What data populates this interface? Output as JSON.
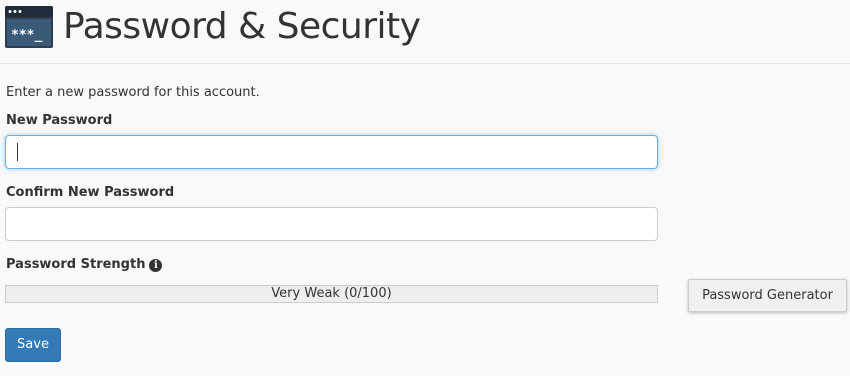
{
  "header": {
    "title": "Password & Security",
    "icon": "password-terminal-icon",
    "icon_text": "***_"
  },
  "form": {
    "description": "Enter a new password for this account.",
    "new_password": {
      "label": "New Password",
      "value": "",
      "placeholder": ""
    },
    "confirm_password": {
      "label": "Confirm New Password",
      "value": "",
      "placeholder": ""
    },
    "strength": {
      "label": "Password Strength",
      "info_icon": "info-circle-icon",
      "text": "Very Weak (0/100)",
      "score": 0,
      "max": 100
    },
    "generator_label": "Password Generator",
    "save_label": "Save"
  },
  "colors": {
    "primary": "#337ab7",
    "focus": "#66afe9",
    "icon_bg": "#2d3e50",
    "strength_weak": "#d9534f"
  }
}
